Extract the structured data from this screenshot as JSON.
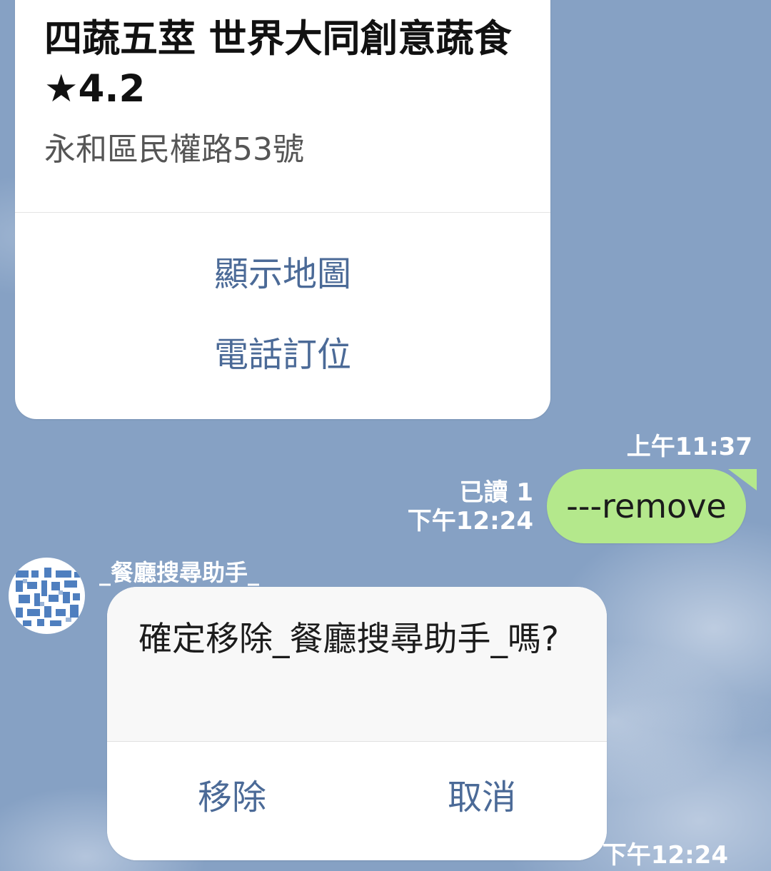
{
  "place_card": {
    "title": "四蔬五莖 世界大同創意蔬食★4.2",
    "address": "永和區民權路53號",
    "actions": {
      "show_map": "顯示地圖",
      "call_reserve": "電話訂位"
    },
    "timestamp": "上午11:37"
  },
  "outgoing_message": {
    "text": "---remove",
    "read_status": "已讀 1",
    "timestamp": "下午12:24",
    "bubble_color": "#b4e88c"
  },
  "bot_message": {
    "sender_name": "_餐廳搜尋助手_",
    "avatar_icon": "qr-pattern-avatar-icon",
    "prompt": "確定移除_餐廳搜尋助手_嗎?",
    "buttons": {
      "remove": "移除",
      "cancel": "取消"
    },
    "timestamp": "下午12:24"
  },
  "colors": {
    "chat_background": "#86a1c4",
    "action_text": "#4b6a97",
    "avatar_pattern": "#4f7fbf"
  }
}
